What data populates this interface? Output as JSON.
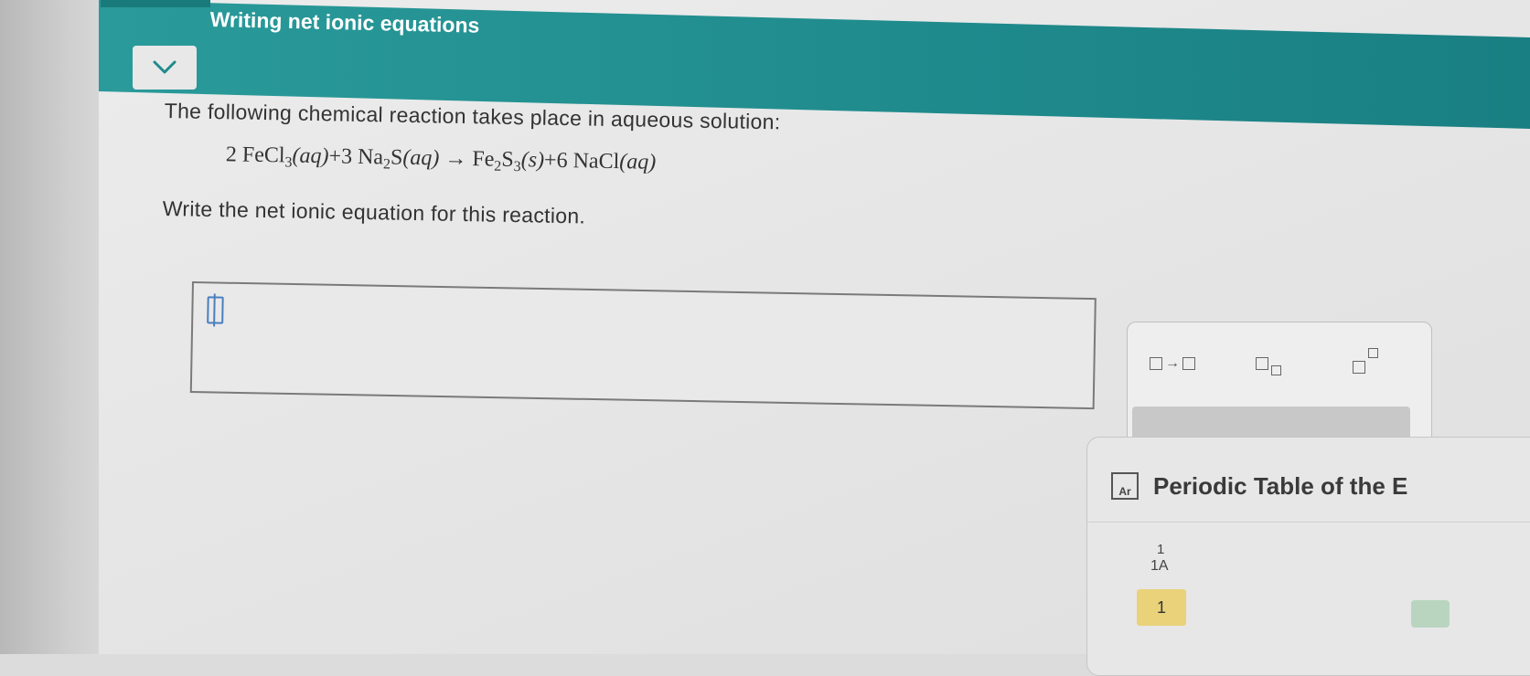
{
  "header": {
    "title": "Writing net ionic equations",
    "accent_color": "#1f8a8c"
  },
  "collapse": {
    "icon": "chevron-down-icon"
  },
  "question": {
    "intro": "The following chemical reaction takes place in aqueous solution:",
    "equation": {
      "r1_coef": "2",
      "r1_formula": "FeCl",
      "r1_sub": "3",
      "r1_state": "(aq)",
      "plus1": "+3",
      "r2_formula": "Na",
      "r2_sub1": "2",
      "r2_formula2": "S",
      "r2_state": "(aq)",
      "arrow": "→",
      "p1_formula": "Fe",
      "p1_sub1": "2",
      "p1_formula2": "S",
      "p1_sub2": "3",
      "p1_state": "(s)",
      "plus2": "+6",
      "p2_formula": "NaCl",
      "p2_state": "(aq)"
    },
    "prompt": "Write the net ionic equation for this reaction."
  },
  "answer": {
    "value": ""
  },
  "toolbar": {
    "buttons": [
      {
        "name": "reaction-arrow-button",
        "icon": "reaction-arrow-icon"
      },
      {
        "name": "subscript-button",
        "icon": "subscript-icon"
      },
      {
        "name": "superscript-button",
        "icon": "superscript-icon"
      }
    ]
  },
  "periodic_table": {
    "icon_label": "Ar",
    "title": "Periodic Table of the E",
    "group_number": "1",
    "group_name": "1A",
    "period_label": "1"
  }
}
